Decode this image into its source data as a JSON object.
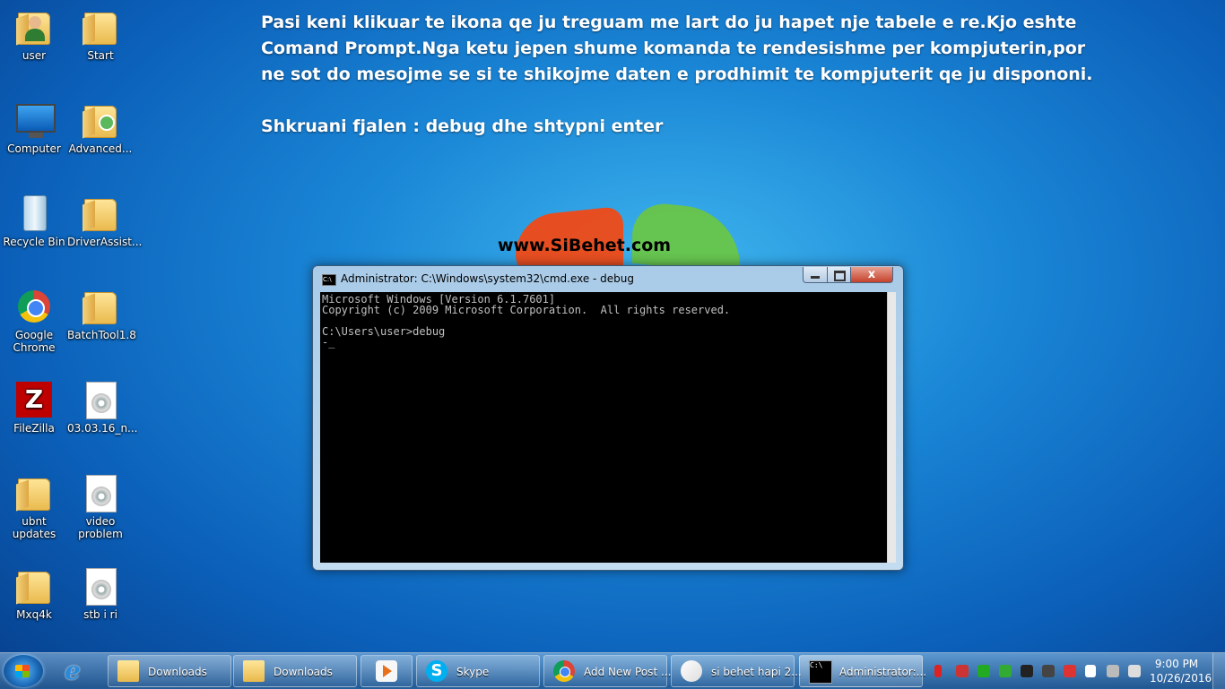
{
  "desktop_icons": [
    {
      "label": "user"
    },
    {
      "label": "Start"
    },
    {
      "label": "Computer"
    },
    {
      "label": "Advanced..."
    },
    {
      "label": "Recycle Bin"
    },
    {
      "label": "DriverAssist..."
    },
    {
      "label": "Google Chrome"
    },
    {
      "label": "BatchTool1.8"
    },
    {
      "label": "FileZilla"
    },
    {
      "label": "03.03.16_n..."
    },
    {
      "label": "ubnt updates"
    },
    {
      "label": "video problem"
    },
    {
      "label": "Mxq4k"
    },
    {
      "label": "stb i ri"
    }
  ],
  "instructions": {
    "line1": "Pasi keni klikuar te ikona qe ju treguam me lart do ju hapet nje tabele e re.Kjo eshte",
    "line2": "Comand Prompt.Nga ketu jepen shume komanda te rendesishme per kompjuterin,por",
    "line3": "ne sot do mesojme se si te shikojme daten e prodhimit te kompjuterit qe ju dispononi.",
    "line4": "Shkruani fjalen : debug dhe shtypni enter"
  },
  "watermark": "www.SiBehet.com",
  "cmd_window": {
    "title": "Administrator: C:\\Windows\\system32\\cmd.exe - debug",
    "icon_text": "C:\\",
    "close_label": "x",
    "line1": "Microsoft Windows [Version 6.1.7601]",
    "line2": "Copyright (c) 2009 Microsoft Corporation.  All rights reserved.",
    "line3": "",
    "line4": "C:\\Users\\user>debug",
    "line5": "-_"
  },
  "taskbar": {
    "ie_glyph": "e",
    "buttons": [
      {
        "label": "Downloads",
        "icon": "folder-icon"
      },
      {
        "label": "Downloads",
        "icon": "folder-icon"
      },
      {
        "label": "",
        "icon": "media-player-icon"
      },
      {
        "label": "Skype",
        "icon": "skype-icon"
      },
      {
        "label": "Add New Post ...",
        "icon": "chrome-icon"
      },
      {
        "label": "si behet hapi 2...",
        "icon": "paint-icon"
      },
      {
        "label": "Administrator:...",
        "icon": "cmd-icon"
      }
    ],
    "skype_glyph": "S",
    "cmd_glyph": "C:\\",
    "clock_time": "9:00 PM",
    "clock_date": "10/26/2016"
  }
}
